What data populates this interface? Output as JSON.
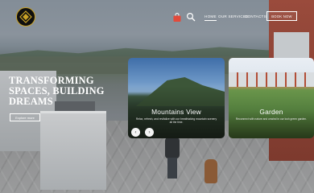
{
  "nav": {
    "links": [
      "HOME",
      "OUR SERVICES",
      "CONTACTS"
    ],
    "book_button": "BOOK NOW",
    "icons": {
      "logo": "crest-logo-icon",
      "cart": "shopping-bag-icon",
      "search": "search-icon"
    }
  },
  "hero": {
    "headline_lines": [
      "TRANSFORMING",
      "SPACES, BUILDING",
      "DREAMS"
    ],
    "explore_button": "Explore more"
  },
  "cards": [
    {
      "title": "Mountains View",
      "description": "Relax, refresh, and revitalize with our breathtaking mountain scenery all the time."
    },
    {
      "title": "Garden",
      "description": "Reconnect with nature and unwind in our lush green garden."
    }
  ],
  "slider": {
    "prev": "‹",
    "next": "›"
  },
  "colors": {
    "accent_gold": "#c9a227",
    "text": "#ffffff"
  }
}
